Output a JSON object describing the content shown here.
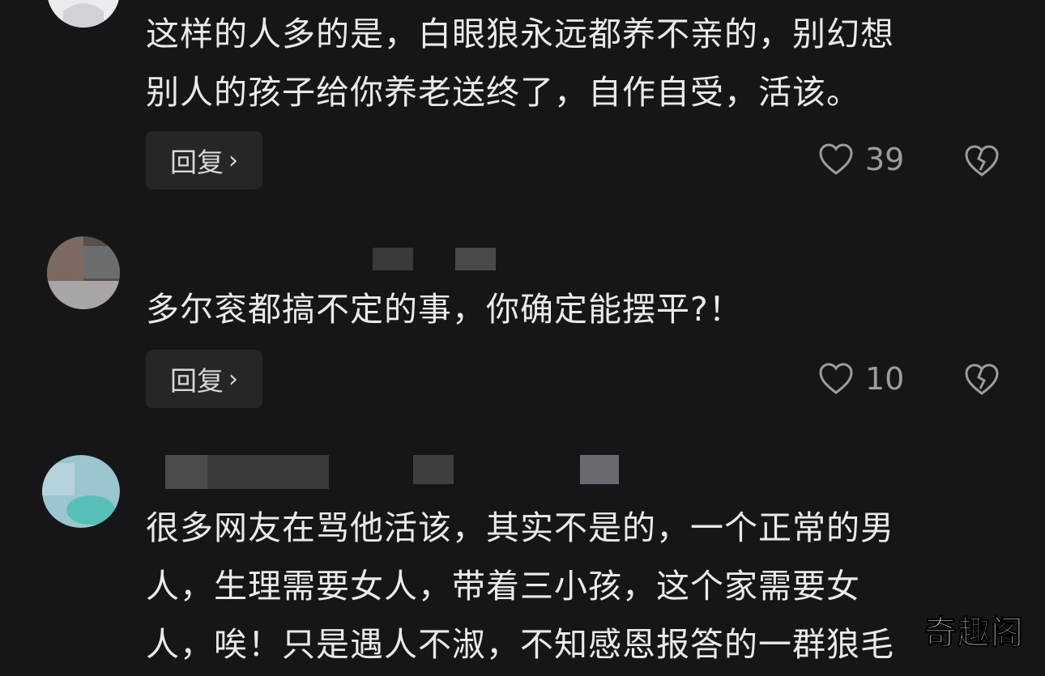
{
  "comments": [
    {
      "text_lines": [
        "这样的人多的是，白眼狼永远都养不亲的，别幻想",
        "别人的孩子给你养老送终了，自作自受，活该。"
      ],
      "reply_label": "回复",
      "reply_chevron": "›",
      "like_count": "39",
      "like_icon": "heart-outline-icon",
      "dislike_icon": "broken-heart-icon"
    },
    {
      "text_lines": [
        "多尔衮都搞不定的事，你确定能摆平?！"
      ],
      "reply_label": "回复",
      "reply_chevron": "›",
      "like_count": "10",
      "like_icon": "heart-outline-icon",
      "dislike_icon": "broken-heart-icon"
    },
    {
      "text_lines": [
        "很多网友在骂他活该，其实不是的，一个正常的男",
        "人，生理需要女人，带着三小孩，这个家需要女",
        "人，唉！只是遇人不淑，不知感恩报答的一群狼毛"
      ]
    }
  ],
  "watermark": "奇趣阁",
  "colors": {
    "background": "#161618",
    "text": "#eaeaec",
    "button_bg": "#262628",
    "icon_gray": "#9c9ca0"
  }
}
